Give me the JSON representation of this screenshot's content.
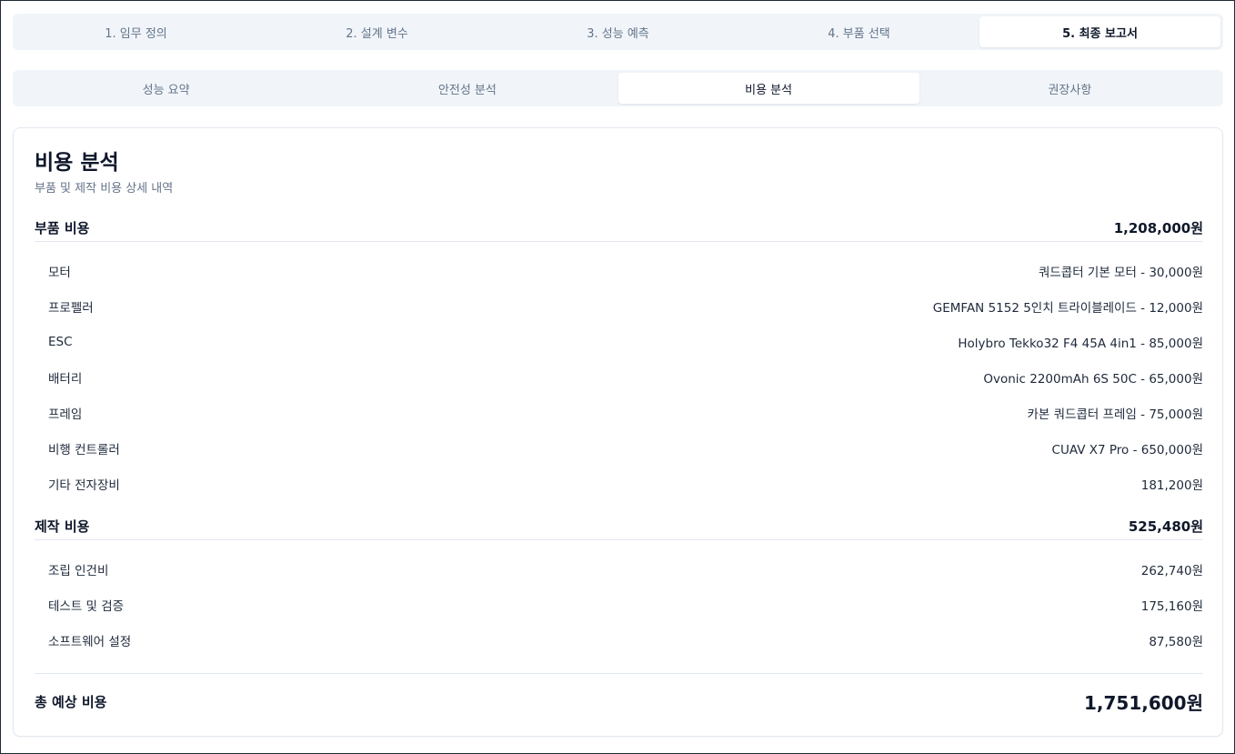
{
  "steps": [
    {
      "label": "1. 임무 정의",
      "active": false
    },
    {
      "label": "2. 설계 변수",
      "active": false
    },
    {
      "label": "3. 성능 예측",
      "active": false
    },
    {
      "label": "4. 부품 선택",
      "active": false
    },
    {
      "label": "5. 최종 보고서",
      "active": true
    }
  ],
  "subtabs": [
    {
      "label": "성능 요약",
      "active": false
    },
    {
      "label": "안전성 분석",
      "active": false
    },
    {
      "label": "비용 분석",
      "active": true
    },
    {
      "label": "권장사항",
      "active": false
    }
  ],
  "card": {
    "title": "비용 분석",
    "subtitle": "부품 및 제작 비용 상세 내역"
  },
  "parts": {
    "label": "부품 비용",
    "total": "1,208,000원",
    "items": [
      {
        "label": "모터",
        "value": "쿼드콥터 기본 모터 - 30,000원"
      },
      {
        "label": "프로펠러",
        "value": "GEMFAN 5152 5인치 트라이블레이드 - 12,000원"
      },
      {
        "label": "ESC",
        "value": "Holybro Tekko32 F4 45A 4in1 - 85,000원"
      },
      {
        "label": "배터리",
        "value": "Ovonic 2200mAh 6S 50C - 65,000원"
      },
      {
        "label": "프레임",
        "value": "카본 쿼드콥터 프레임 - 75,000원"
      },
      {
        "label": "비행 컨트롤러",
        "value": "CUAV X7 Pro - 650,000원"
      },
      {
        "label": "기타 전자장비",
        "value": "181,200원"
      }
    ]
  },
  "manufacturing": {
    "label": "제작 비용",
    "total": "525,480원",
    "items": [
      {
        "label": "조립 인건비",
        "value": "262,740원"
      },
      {
        "label": "테스트 및 검증",
        "value": "175,160원"
      },
      {
        "label": "소프트웨어 설정",
        "value": "87,580원"
      }
    ]
  },
  "total": {
    "label": "총 예상 비용",
    "value": "1,751,600원"
  }
}
